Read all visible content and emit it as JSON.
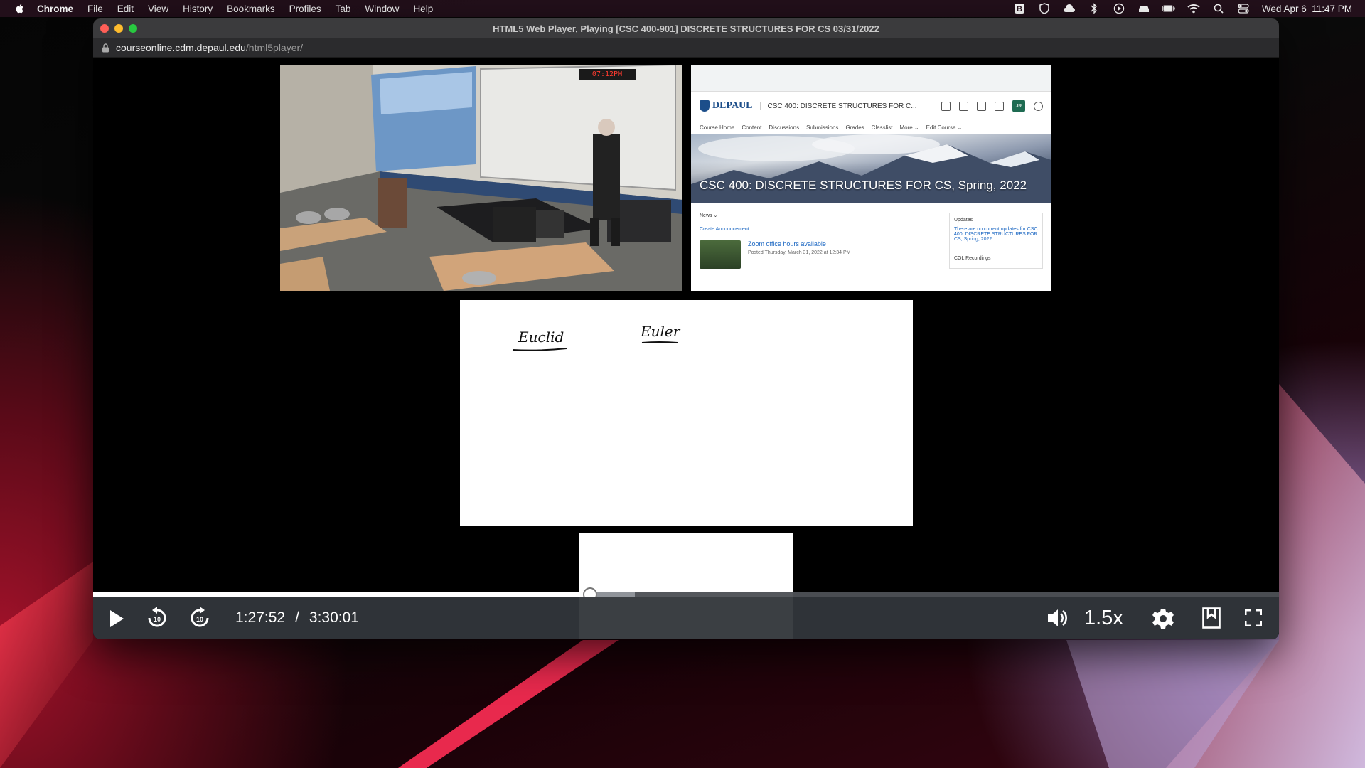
{
  "menubar": {
    "app_name": "Chrome",
    "items": [
      "File",
      "Edit",
      "View",
      "History",
      "Bookmarks",
      "Profiles",
      "Tab",
      "Window",
      "Help"
    ],
    "clock": "Wed Apr 6  11:47 PM",
    "status_icons": [
      "b-icon",
      "shield-icon",
      "cloud-icon",
      "bluetooth-icon",
      "play-circle-icon",
      "car-icon",
      "battery-icon",
      "wifi-icon",
      "search-icon",
      "control-center-icon"
    ]
  },
  "window": {
    "title": "HTML5 Web Player, Playing [CSC 400-901] DISCRETE STRUCTURES FOR CS 03/31/2022",
    "url_host": "courseonline.cdm.depaul.edu",
    "url_path": "/html5player/"
  },
  "camera": {
    "clock_display": "07:12PM"
  },
  "screenshare": {
    "logo": "DEPAUL",
    "course_short": "CSC 400: DISCRETE STRUCTURES FOR C...",
    "user_initials": "JR",
    "nav": [
      "Course Home",
      "Content",
      "Discussions",
      "Submissions",
      "Grades",
      "Classlist",
      "More ⌄",
      "Edit Course ⌄"
    ],
    "banner_title": "CSC 400: DISCRETE STRUCTURES FOR CS, Spring, 2022",
    "news_label": "News ⌄",
    "create_announcement": "Create Announcement",
    "news_item_title": "Zoom office hours available",
    "news_item_meta": "Posted Thursday, March 31, 2022 at 12:34 PM",
    "updates_label": "Updates",
    "updates_text": "There are no current updates for CSC 400: DISCRETE STRUCTURES FOR CS, Spring, 2022",
    "col_recordings": "COL Recordings"
  },
  "whiteboard": {
    "words": [
      "Euclid",
      "Euler"
    ]
  },
  "player": {
    "current_time": "1:27:52",
    "separator": "/",
    "duration": "3:30:01",
    "played_fraction": 0.419,
    "buffered_fraction": 0.457,
    "speed": "1.5x",
    "skip_seconds": "10"
  },
  "colors": {
    "control_bar": "#2f3338",
    "seek_track": "#4a4d52",
    "seek_played": "#ffffff"
  }
}
